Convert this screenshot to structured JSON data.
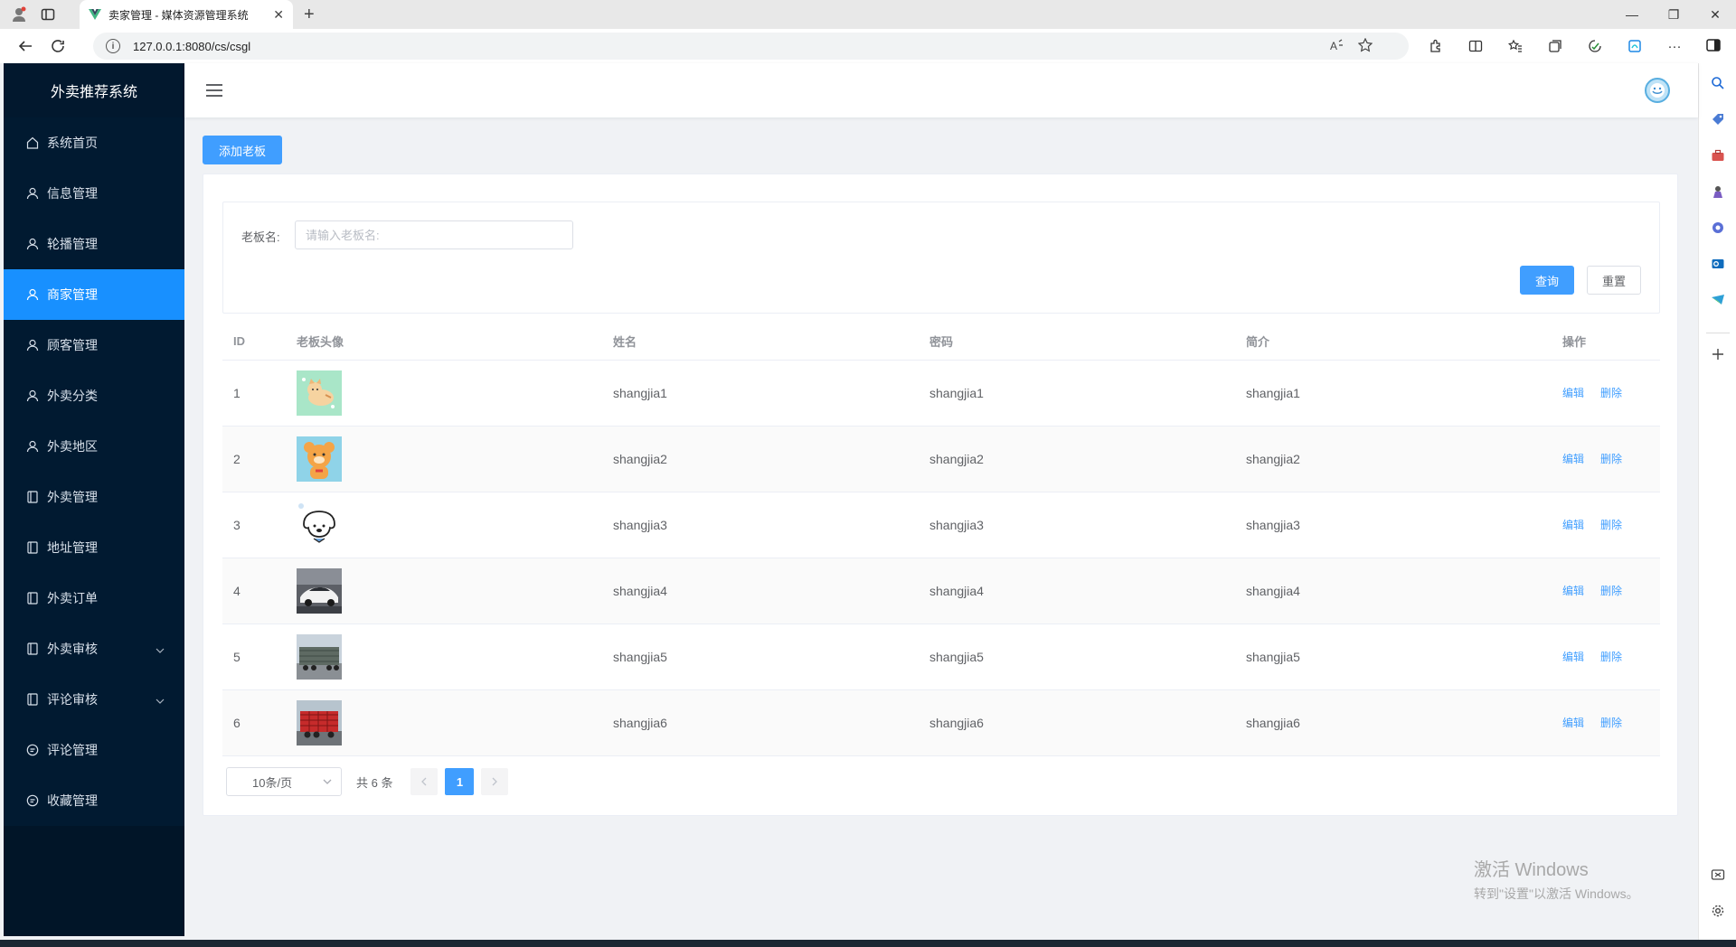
{
  "browser": {
    "tab_title": "卖家管理 - 媒体资源管理系统",
    "url": "127.0.0.1:8080/cs/csgl"
  },
  "sidebar": {
    "title": "外卖推荐系统",
    "items": [
      {
        "label": "系统首页",
        "icon": "home-icon"
      },
      {
        "label": "信息管理",
        "icon": "user-icon"
      },
      {
        "label": "轮播管理",
        "icon": "user-icon"
      },
      {
        "label": "商家管理",
        "icon": "user-icon",
        "active": true
      },
      {
        "label": "顾客管理",
        "icon": "user-icon"
      },
      {
        "label": "外卖分类",
        "icon": "user-icon"
      },
      {
        "label": "外卖地区",
        "icon": "user-icon"
      },
      {
        "label": "外卖管理",
        "icon": "document-icon"
      },
      {
        "label": "地址管理",
        "icon": "document-icon"
      },
      {
        "label": "外卖订单",
        "icon": "document-icon"
      },
      {
        "label": "外卖审核",
        "icon": "document-icon",
        "expandable": true
      },
      {
        "label": "评论审核",
        "icon": "document-icon",
        "expandable": true
      },
      {
        "label": "评论管理",
        "icon": "chat-icon"
      },
      {
        "label": "收藏管理",
        "icon": "chat-icon"
      }
    ]
  },
  "toolbar": {
    "add_label": "添加老板"
  },
  "search": {
    "label": "老板名:",
    "placeholder": "请输入老板名:",
    "query_label": "查询",
    "reset_label": "重置"
  },
  "table": {
    "headers": [
      "ID",
      "老板头像",
      "姓名",
      "密码",
      "简介",
      "操作"
    ],
    "rows": [
      {
        "id": "1",
        "name": "shangjia1",
        "password": "shangjia1",
        "intro": "shangjia1",
        "avatar": "cat-sticker"
      },
      {
        "id": "2",
        "name": "shangjia2",
        "password": "shangjia2",
        "intro": "shangjia2",
        "avatar": "bear-sticker"
      },
      {
        "id": "3",
        "name": "shangjia3",
        "password": "shangjia3",
        "intro": "shangjia3",
        "avatar": "dog-sketch"
      },
      {
        "id": "4",
        "name": "shangjia4",
        "password": "shangjia4",
        "intro": "shangjia4",
        "avatar": "white-car-photo"
      },
      {
        "id": "5",
        "name": "shangjia5",
        "password": "shangjia5",
        "intro": "shangjia5",
        "avatar": "gray-truck-photo"
      },
      {
        "id": "6",
        "name": "shangjia6",
        "password": "shangjia6",
        "intro": "shangjia6",
        "avatar": "red-truck-photo"
      }
    ],
    "edit_label": "编辑",
    "delete_label": "删除"
  },
  "pagination": {
    "page_size": "10条/页",
    "total": "共 6 条",
    "current": "1"
  },
  "watermark": {
    "line1": "激活 Windows",
    "line2": "转到\"设置\"以激活 Windows。"
  },
  "colors": {
    "primary": "#409eff",
    "sidebar_bg": "#011528",
    "active_menu": "#1890ff"
  }
}
